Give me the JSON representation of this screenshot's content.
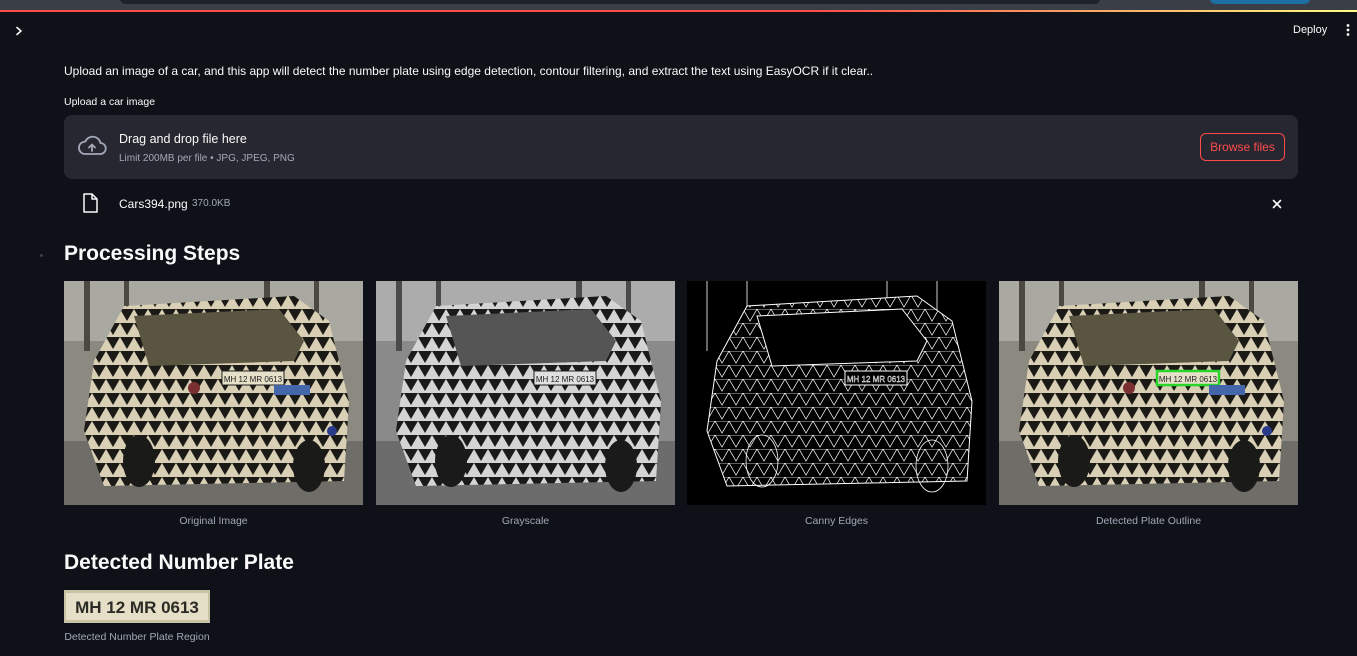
{
  "header": {
    "deploy_label": "Deploy"
  },
  "intro": {
    "text": "Upload an image of a car, and this app will detect the number plate using edge detection, contour filtering, and extract the text using EasyOCR if it clear.."
  },
  "uploader": {
    "label": "Upload a car image",
    "drop_title": "Drag and drop file here",
    "limit_text": "Limit 200MB per file • JPG, JPEG, PNG",
    "browse_label": "Browse files",
    "file": {
      "name": "Cars394.png",
      "size": "370.0KB"
    }
  },
  "steps": {
    "heading": "Processing Steps",
    "images": [
      {
        "caption": "Original Image",
        "plate_text": "MH 12 MR 0613"
      },
      {
        "caption": "Grayscale",
        "plate_text": "MH 12 MR 0613"
      },
      {
        "caption": "Canny Edges",
        "plate_text": "MH 12 MR 0613"
      },
      {
        "caption": "Detected Plate Outline",
        "plate_text": "MH 12 MR 0613"
      }
    ]
  },
  "plate": {
    "heading": "Detected Number Plate",
    "image_text": "MH 12 MR 0613",
    "caption": "Detected Number Plate Region"
  },
  "colors": {
    "background": "#0e1117",
    "accent": "#ff4b4b",
    "secondary_bg": "#262730",
    "outline_box": "#2bd42b"
  }
}
